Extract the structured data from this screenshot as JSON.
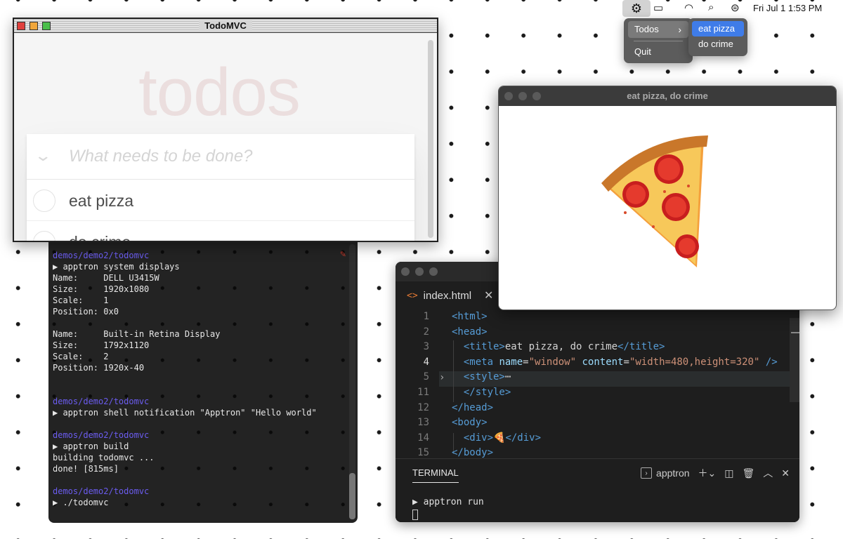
{
  "menubar": {
    "gear_icon": "gear-icon",
    "battery_icon": "battery-icon",
    "wifi_icon": "wifi-icon",
    "search_icon": "search-icon",
    "control_center_icon": "control-center-icon",
    "date_time": "Fri Jul 1  1:53 PM"
  },
  "tray_menu": {
    "items": [
      {
        "label": "Todos",
        "submenu": true
      },
      {
        "label": "Quit"
      }
    ],
    "submenu_items": [
      {
        "label": "eat pizza",
        "selected": true
      },
      {
        "label": "do crime"
      }
    ]
  },
  "todo_window": {
    "title": "TodoMVC",
    "heading": "todos",
    "input_placeholder": "What needs to be done?",
    "items": [
      {
        "label": "eat pizza"
      },
      {
        "label": "do crime"
      }
    ]
  },
  "terminal": {
    "lines": [
      {
        "text": "demos/demo2/todomvc",
        "kind": "path"
      },
      {
        "text": "▶ apptron system displays",
        "kind": "cmd"
      },
      {
        "text": "Name:     DELL U3415W",
        "kind": "out"
      },
      {
        "text": "Size:     1920x1080",
        "kind": "out"
      },
      {
        "text": "Scale:    1",
        "kind": "out"
      },
      {
        "text": "Position: 0x0",
        "kind": "out"
      },
      {
        "text": "",
        "kind": "out"
      },
      {
        "text": "Name:     Built-in Retina Display",
        "kind": "out"
      },
      {
        "text": "Size:     1792x1120",
        "kind": "out"
      },
      {
        "text": "Scale:    2",
        "kind": "out"
      },
      {
        "text": "Position: 1920x-40",
        "kind": "out"
      },
      {
        "text": "",
        "kind": "out"
      },
      {
        "text": "",
        "kind": "out"
      },
      {
        "text": "demos/demo2/todomvc",
        "kind": "path"
      },
      {
        "text": "▶ apptron shell notification \"Apptron\" \"Hello world\"",
        "kind": "cmd"
      },
      {
        "text": "",
        "kind": "out"
      },
      {
        "text": "demos/demo2/todomvc",
        "kind": "path"
      },
      {
        "text": "▶ apptron build",
        "kind": "cmd"
      },
      {
        "text": "building todomvc ...",
        "kind": "out"
      },
      {
        "text": "done! [815ms]",
        "kind": "out"
      },
      {
        "text": "",
        "kind": "out"
      },
      {
        "text": "demos/demo2/todomvc",
        "kind": "path"
      },
      {
        "text": "▶ ./todomvc",
        "kind": "cmd"
      }
    ]
  },
  "editor": {
    "tab_label": "index.html",
    "lines": [
      {
        "n": "1",
        "html": "<span class='tg'>&lt;html&gt;</span>"
      },
      {
        "n": "2",
        "html": "<span class='tg'>&lt;head&gt;</span>"
      },
      {
        "n": "3",
        "html": "  <span class='tg'>&lt;title&gt;</span>eat pizza, do crime<span class='tg'>&lt;/title&gt;</span>"
      },
      {
        "n": "4",
        "html": "  <span class='tg'>&lt;meta</span> <span class='at'>name</span>=<span class='st'>\"window\"</span> <span class='at'>content</span>=<span class='st'>\"width=480,height=320\"</span> <span class='tg'>/&gt;</span>"
      },
      {
        "n": "5",
        "html": "  <span class='tg'>&lt;style&gt;</span><span class='pl'>⋯</span>"
      },
      {
        "n": "11",
        "html": "  <span class='tg'>&lt;/style&gt;</span>"
      },
      {
        "n": "12",
        "html": "<span class='tg'>&lt;/head&gt;</span>"
      },
      {
        "n": "13",
        "html": "<span class='tg'>&lt;body&gt;</span>"
      },
      {
        "n": "14",
        "html": "  <span class='tg'>&lt;div&gt;</span>🍕<span class='tg'>&lt;/div&gt;</span>"
      },
      {
        "n": "15",
        "html": "<span class='tg'>&lt;/body&gt;</span>"
      }
    ],
    "panel_tab": "TERMINAL",
    "terminal_profile": "apptron",
    "terminal_command": "▶ apptron run"
  },
  "pizza_window": {
    "title": "eat pizza, do crime",
    "emoji_name": "pizza-emoji"
  },
  "colors": {
    "menu_highlight": "#3f7ce8",
    "terminal_path": "#6b5cf0",
    "html_tag": "#569cd6",
    "html_attr": "#9cdcfe",
    "html_string": "#ce9178"
  }
}
